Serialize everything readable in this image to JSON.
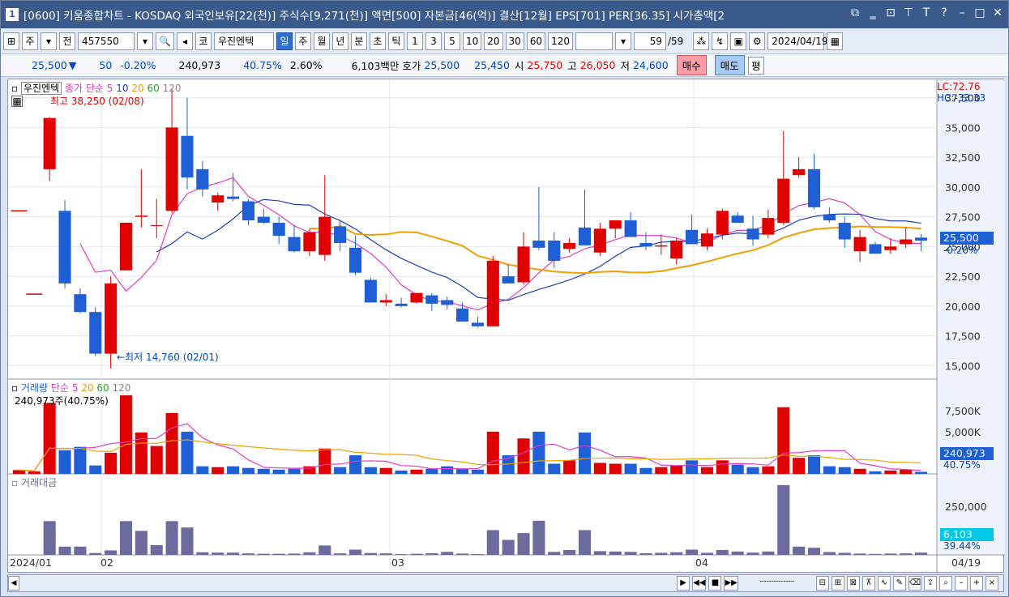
{
  "title": {
    "num": "1",
    "text": "[0600] 키움종합차트 - KOSDAQ 외국인보유[22(천)] 주식수[9,271(천)] 액면[500] 자본금[46(억)] 결산[12월] EPS[701] PER[36.35] 시가총액[2"
  },
  "toolbar": {
    "type": "주",
    "prev": "전",
    "code": "457550",
    "market": "코",
    "stock": "우진엔텍",
    "periods": [
      "일",
      "주",
      "월",
      "년",
      "분",
      "초",
      "틱"
    ],
    "intervals": [
      "1",
      "3",
      "5",
      "10",
      "20",
      "30",
      "60",
      "120"
    ],
    "count": "59",
    "total": "/59",
    "date": "2024/04/19"
  },
  "quote": {
    "price": "25,500",
    "arrow": "▼",
    "change": "50",
    "change_pct": "-0.20%",
    "volume": "240,973",
    "vol_ratio": "40.75%",
    "turnover": "2.60%",
    "amount": "6,103백만",
    "bid_label": "호가",
    "ask": "25,500",
    "bid": "25,450",
    "open_label": "시",
    "open": "25,750",
    "high_label": "고",
    "high": "26,050",
    "low_label": "저",
    "low": "24,600",
    "buy": "매수",
    "sell": "매도",
    "avg": "평"
  },
  "price_panel": {
    "name": "우진엔텍",
    "ma_label": "종가 단순",
    "ma_periods": [
      "5",
      "10",
      "20",
      "60",
      "120"
    ],
    "ma_colors": [
      "#e03cc8",
      "#1f3fb5",
      "#f0a000",
      "#2aa02a",
      "#888888"
    ],
    "lc": "LC:72.76",
    "hc": "HC:-33.33",
    "hi_note": "최고 38,250 (02/08)",
    "lo_note": "←최저 14,760 (02/01)",
    "ticks": [
      "37,500",
      "35,000",
      "32,500",
      "30,000",
      "27,500",
      "25,000",
      "22,500",
      "20,000",
      "17,500",
      "15,000"
    ],
    "last": "25,500",
    "last_pct": "-0.20%"
  },
  "volume_panel": {
    "name": "거래량",
    "ma_label": "단순",
    "ma_periods": [
      "5",
      "20",
      "60",
      "120"
    ],
    "value_note": "240,973주(40.75%)",
    "ticks": [
      "7,500K",
      "5,000K",
      "2,500K"
    ],
    "last": "240,973",
    "last_pct": "40.75%"
  },
  "amount_panel": {
    "name": "거래대금",
    "ticks": [
      "250,000"
    ],
    "last": "6,103",
    "last_pct": "39.44%"
  },
  "xaxis": {
    "labels": [
      "2024/01",
      "02",
      "03",
      "04"
    ],
    "last": "04/19"
  },
  "chart_data": {
    "type": "candlestick",
    "ylim": [
      14000,
      38500
    ],
    "candles": [
      [
        28000,
        null,
        null,
        28000
      ],
      [
        21000,
        null,
        null,
        21000
      ],
      [
        31500,
        35900,
        30500,
        35800
      ],
      [
        28000,
        28900,
        21500,
        21900
      ],
      [
        21000,
        21500,
        19400,
        19500
      ],
      [
        19500,
        19900,
        15800,
        16000
      ],
      [
        16000,
        22500,
        14760,
        21900
      ],
      [
        23000,
        25500,
        23000,
        27000
      ],
      [
        27500,
        31500,
        26600,
        27600
      ],
      [
        26800,
        29000,
        25700,
        26800
      ],
      [
        28000,
        38250,
        27800,
        35000
      ],
      [
        34300,
        37500,
        29800,
        30800
      ],
      [
        31500,
        32200,
        29200,
        29800
      ],
      [
        28700,
        29500,
        28000,
        29300
      ],
      [
        29200,
        31200,
        28800,
        29000
      ],
      [
        28800,
        29000,
        26800,
        27200
      ],
      [
        27500,
        28200,
        26900,
        27000
      ],
      [
        27000,
        27500,
        25200,
        25900
      ],
      [
        25800,
        26800,
        24500,
        24600
      ],
      [
        24600,
        26500,
        24200,
        26200
      ],
      [
        24300,
        31000,
        23800,
        27500
      ],
      [
        26700,
        27200,
        24600,
        25300
      ],
      [
        24900,
        25900,
        22600,
        22800
      ],
      [
        22200,
        22400,
        20300,
        20300
      ],
      [
        20300,
        21000,
        20000,
        20500
      ],
      [
        20200,
        20700,
        19900,
        20000
      ],
      [
        20300,
        21100,
        20200,
        21100
      ],
      [
        20900,
        21100,
        19600,
        20200
      ],
      [
        20500,
        20800,
        19700,
        20100
      ],
      [
        19800,
        20300,
        19100,
        18700
      ],
      [
        18600,
        19100,
        18200,
        18300
      ],
      [
        18300,
        24200,
        18300,
        23800
      ],
      [
        22500,
        23500,
        22000,
        21900
      ],
      [
        22000,
        26200,
        21800,
        25000
      ],
      [
        25500,
        30000,
        24700,
        24900
      ],
      [
        25500,
        26200,
        23200,
        23800
      ],
      [
        24800,
        25700,
        24500,
        25300
      ],
      [
        26600,
        29800,
        25400,
        25100
      ],
      [
        24500,
        27000,
        24200,
        26500
      ],
      [
        26500,
        27000,
        25700,
        27200
      ],
      [
        27200,
        27900,
        26100,
        25800
      ],
      [
        25300,
        26200,
        24700,
        25000
      ],
      [
        25000,
        26000,
        24300,
        25100
      ],
      [
        24000,
        25700,
        23500,
        25500
      ],
      [
        26400,
        27700,
        25500,
        25200
      ],
      [
        25000,
        26500,
        24700,
        26100
      ],
      [
        26000,
        28200,
        25600,
        28000
      ],
      [
        27600,
        27900,
        27200,
        27000
      ],
      [
        26500,
        27600,
        25100,
        25600
      ],
      [
        26000,
        28100,
        25700,
        27400
      ],
      [
        27000,
        34700,
        26800,
        30700
      ],
      [
        31000,
        32500,
        30800,
        31500
      ],
      [
        31500,
        32800,
        28100,
        28300
      ],
      [
        27700,
        28300,
        27000,
        27200
      ],
      [
        27000,
        27500,
        24900,
        25600
      ],
      [
        24600,
        26400,
        23700,
        25800
      ],
      [
        25200,
        25400,
        24400,
        24400
      ],
      [
        24700,
        25700,
        24400,
        25000
      ],
      [
        25200,
        26600,
        24900,
        25600
      ],
      [
        25750,
        26050,
        24600,
        25500
      ]
    ],
    "volume": [
      450,
      300,
      8400,
      2800,
      3200,
      1000,
      2500,
      9300,
      4900,
      3300,
      7200,
      5000,
      900,
      800,
      900,
      700,
      600,
      500,
      600,
      900,
      3000,
      800,
      2200,
      800,
      700,
      400,
      500,
      600,
      900,
      600,
      500,
      5000,
      2200,
      4200,
      5000,
      1200,
      1600,
      4900,
      1300,
      1200,
      1200,
      700,
      800,
      1000,
      1600,
      800,
      1600,
      1100,
      800,
      900,
      7900,
      1900,
      2200,
      900,
      800,
      600,
      300,
      400,
      500,
      241
    ],
    "amount": [
      20,
      20,
      90000,
      22000,
      22000,
      5000,
      12000,
      90000,
      64000,
      26000,
      90000,
      73000,
      7000,
      6000,
      6000,
      4000,
      3000,
      3000,
      3500,
      7000,
      25000,
      4000,
      14000,
      5000,
      4000,
      2000,
      3000,
      4500,
      8000,
      3500,
      2000,
      66000,
      40000,
      58000,
      91000,
      8000,
      13000,
      66000,
      10000,
      9000,
      8000,
      4500,
      5500,
      7000,
      14000,
      5500,
      13000,
      9000,
      6000,
      9000,
      186000,
      22000,
      19000,
      7500,
      5500,
      3500,
      2500,
      3500,
      4000,
      6103
    ]
  }
}
